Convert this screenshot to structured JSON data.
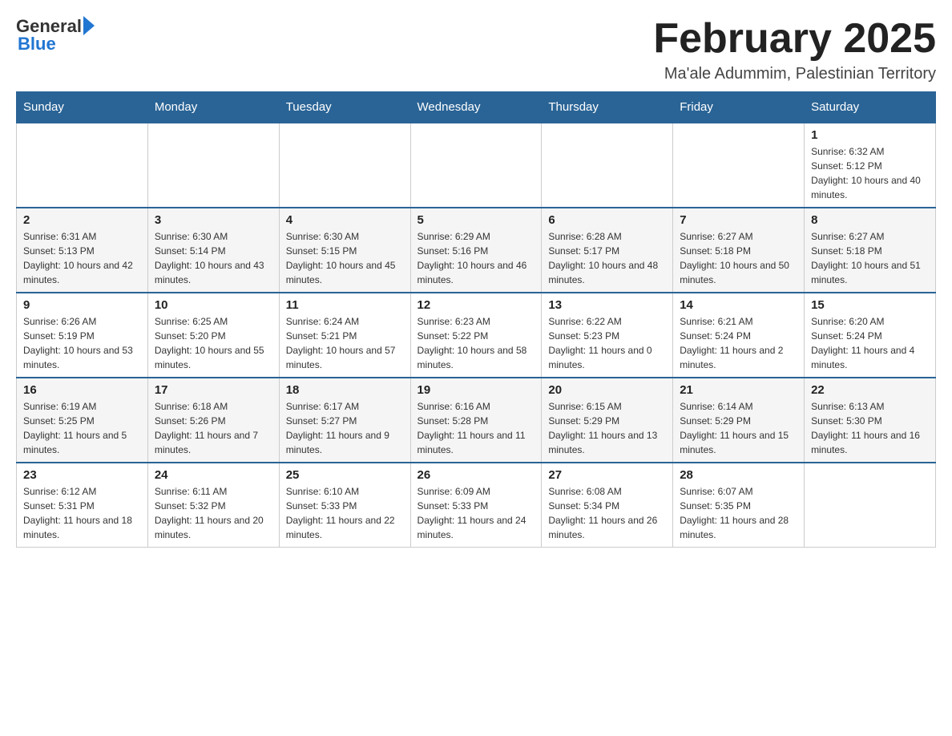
{
  "header": {
    "logo_general": "General",
    "logo_blue": "Blue",
    "title": "February 2025",
    "location": "Ma'ale Adummim, Palestinian Territory"
  },
  "days_of_week": [
    "Sunday",
    "Monday",
    "Tuesday",
    "Wednesday",
    "Thursday",
    "Friday",
    "Saturday"
  ],
  "weeks": [
    {
      "days": [
        {
          "num": "",
          "info": ""
        },
        {
          "num": "",
          "info": ""
        },
        {
          "num": "",
          "info": ""
        },
        {
          "num": "",
          "info": ""
        },
        {
          "num": "",
          "info": ""
        },
        {
          "num": "",
          "info": ""
        },
        {
          "num": "1",
          "info": "Sunrise: 6:32 AM\nSunset: 5:12 PM\nDaylight: 10 hours and 40 minutes."
        }
      ]
    },
    {
      "days": [
        {
          "num": "2",
          "info": "Sunrise: 6:31 AM\nSunset: 5:13 PM\nDaylight: 10 hours and 42 minutes."
        },
        {
          "num": "3",
          "info": "Sunrise: 6:30 AM\nSunset: 5:14 PM\nDaylight: 10 hours and 43 minutes."
        },
        {
          "num": "4",
          "info": "Sunrise: 6:30 AM\nSunset: 5:15 PM\nDaylight: 10 hours and 45 minutes."
        },
        {
          "num": "5",
          "info": "Sunrise: 6:29 AM\nSunset: 5:16 PM\nDaylight: 10 hours and 46 minutes."
        },
        {
          "num": "6",
          "info": "Sunrise: 6:28 AM\nSunset: 5:17 PM\nDaylight: 10 hours and 48 minutes."
        },
        {
          "num": "7",
          "info": "Sunrise: 6:27 AM\nSunset: 5:18 PM\nDaylight: 10 hours and 50 minutes."
        },
        {
          "num": "8",
          "info": "Sunrise: 6:27 AM\nSunset: 5:18 PM\nDaylight: 10 hours and 51 minutes."
        }
      ]
    },
    {
      "days": [
        {
          "num": "9",
          "info": "Sunrise: 6:26 AM\nSunset: 5:19 PM\nDaylight: 10 hours and 53 minutes."
        },
        {
          "num": "10",
          "info": "Sunrise: 6:25 AM\nSunset: 5:20 PM\nDaylight: 10 hours and 55 minutes."
        },
        {
          "num": "11",
          "info": "Sunrise: 6:24 AM\nSunset: 5:21 PM\nDaylight: 10 hours and 57 minutes."
        },
        {
          "num": "12",
          "info": "Sunrise: 6:23 AM\nSunset: 5:22 PM\nDaylight: 10 hours and 58 minutes."
        },
        {
          "num": "13",
          "info": "Sunrise: 6:22 AM\nSunset: 5:23 PM\nDaylight: 11 hours and 0 minutes."
        },
        {
          "num": "14",
          "info": "Sunrise: 6:21 AM\nSunset: 5:24 PM\nDaylight: 11 hours and 2 minutes."
        },
        {
          "num": "15",
          "info": "Sunrise: 6:20 AM\nSunset: 5:24 PM\nDaylight: 11 hours and 4 minutes."
        }
      ]
    },
    {
      "days": [
        {
          "num": "16",
          "info": "Sunrise: 6:19 AM\nSunset: 5:25 PM\nDaylight: 11 hours and 5 minutes."
        },
        {
          "num": "17",
          "info": "Sunrise: 6:18 AM\nSunset: 5:26 PM\nDaylight: 11 hours and 7 minutes."
        },
        {
          "num": "18",
          "info": "Sunrise: 6:17 AM\nSunset: 5:27 PM\nDaylight: 11 hours and 9 minutes."
        },
        {
          "num": "19",
          "info": "Sunrise: 6:16 AM\nSunset: 5:28 PM\nDaylight: 11 hours and 11 minutes."
        },
        {
          "num": "20",
          "info": "Sunrise: 6:15 AM\nSunset: 5:29 PM\nDaylight: 11 hours and 13 minutes."
        },
        {
          "num": "21",
          "info": "Sunrise: 6:14 AM\nSunset: 5:29 PM\nDaylight: 11 hours and 15 minutes."
        },
        {
          "num": "22",
          "info": "Sunrise: 6:13 AM\nSunset: 5:30 PM\nDaylight: 11 hours and 16 minutes."
        }
      ]
    },
    {
      "days": [
        {
          "num": "23",
          "info": "Sunrise: 6:12 AM\nSunset: 5:31 PM\nDaylight: 11 hours and 18 minutes."
        },
        {
          "num": "24",
          "info": "Sunrise: 6:11 AM\nSunset: 5:32 PM\nDaylight: 11 hours and 20 minutes."
        },
        {
          "num": "25",
          "info": "Sunrise: 6:10 AM\nSunset: 5:33 PM\nDaylight: 11 hours and 22 minutes."
        },
        {
          "num": "26",
          "info": "Sunrise: 6:09 AM\nSunset: 5:33 PM\nDaylight: 11 hours and 24 minutes."
        },
        {
          "num": "27",
          "info": "Sunrise: 6:08 AM\nSunset: 5:34 PM\nDaylight: 11 hours and 26 minutes."
        },
        {
          "num": "28",
          "info": "Sunrise: 6:07 AM\nSunset: 5:35 PM\nDaylight: 11 hours and 28 minutes."
        },
        {
          "num": "",
          "info": ""
        }
      ]
    }
  ]
}
